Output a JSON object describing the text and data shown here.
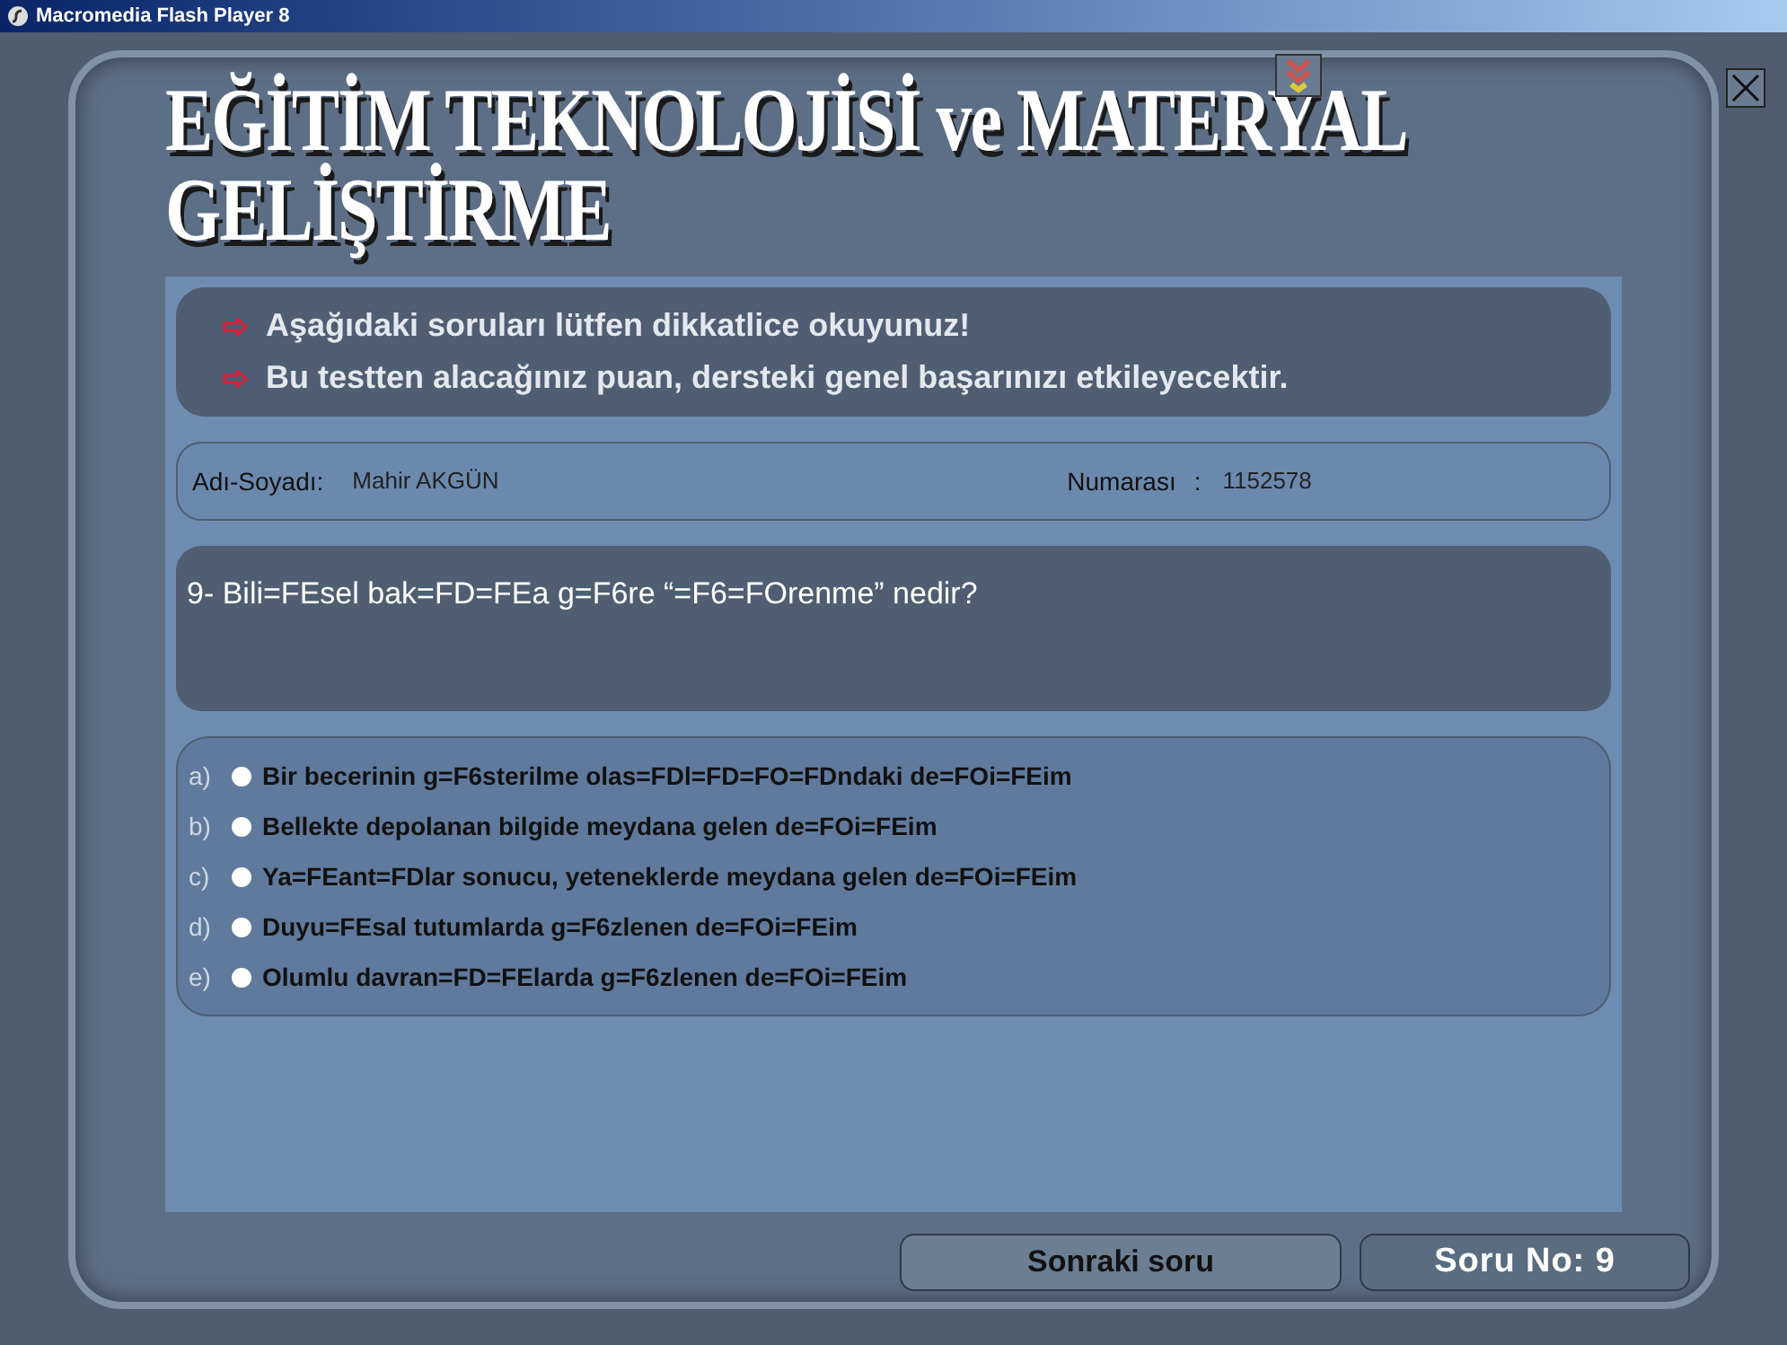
{
  "window": {
    "title": "Macromedia Flash Player 8"
  },
  "header": {
    "title": "EĞİTİM TEKNOLOJİSİ ve MATERYAL GELİŞTİRME"
  },
  "notices": [
    "Aşağıdaki soruları lütfen dikkatlice okuyunuz!",
    "Bu testten alacağınız puan, dersteki genel başarınızı etkileyecektir."
  ],
  "student": {
    "name_label": "Adı-Soyadı:",
    "name": "Mahir AKGÜN",
    "number_label": "Numarası",
    "number_sep": ":",
    "number": "1152578"
  },
  "question": "9- Bili=FEsel bak=FD=FEa g=F6re “=F6=FOrenme” nedir?",
  "options": [
    {
      "letter": "a)",
      "text": "Bir becerinin g=F6sterilme olas=FDl=FD=FO=FDndaki de=FOi=FEim",
      "selected": false
    },
    {
      "letter": "b)",
      "text": "Bellekte depolanan bilgide meydana gelen de=FOi=FEim",
      "selected": false
    },
    {
      "letter": "c)",
      "text": "Ya=FEant=FDlar sonucu, yeteneklerde meydana gelen de=FOi=FEim",
      "selected": false
    },
    {
      "letter": "d)",
      "text": "Duyu=FEsal tutumlarda g=F6zlenen de=FOi=FEim",
      "selected": false
    },
    {
      "letter": "e)",
      "text": "Olumlu davran=FD=FElarda g=F6zlenen de=FOi=FEim",
      "selected": false
    }
  ],
  "footer": {
    "next_button": "Sonraki soru",
    "question_no": "Soru No: 9"
  }
}
